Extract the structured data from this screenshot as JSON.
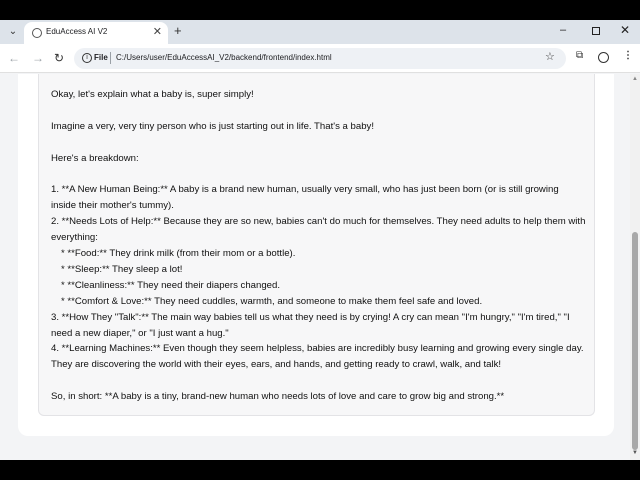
{
  "browser": {
    "tab": {
      "title": "EduAccess AI V2",
      "close_glyph": "✕",
      "favicon": "globe-icon"
    },
    "new_tab_glyph": "+",
    "tab_search_glyph": "⌄",
    "window_controls": {
      "minimize": "–",
      "close": "✕"
    },
    "toolbar": {
      "back_glyph": "←",
      "forward_glyph": "→",
      "reload_glyph": "↻",
      "info_glyph": "i",
      "scheme_label": "File",
      "url": "C:/Users/user/EduAccessAI_V2/backend/frontend/index.html",
      "star_glyph": "☆",
      "extension_glyph": "⧉",
      "menu_glyph": "⋮"
    }
  },
  "response": {
    "intro": "Okay, let's explain what a baby is, super simply!",
    "line2": "Imagine a very, very tiny person who is just starting out in life. That's a baby!",
    "line3": "Here's a breakdown:",
    "item1": "1.  **A New Human Being:** A baby is a brand new human, usually very small, who has just been born (or is still growing inside their mother's tummy).",
    "item2": "2.  **Needs Lots of Help:** Because they are so new, babies can't do much for themselves. They need adults to help them with everything:",
    "bullet1": "*    **Food:** They drink milk (from their mom or a bottle).",
    "bullet2": "*    **Sleep:** They sleep a lot!",
    "bullet3": "*    **Cleanliness:** They need their diapers changed.",
    "bullet4": "*    **Comfort & Love:** They need cuddles, warmth, and someone to make them feel safe and loved.",
    "item3": "3.  **How They \"Talk\":** The main way babies tell us what they need is by crying! A cry can mean \"I'm hungry,\" \"I'm tired,\" \"I need a new diaper,\" or \"I just want a hug.\"",
    "item4": "4.  **Learning Machines:** Even though they seem helpless, babies are incredibly busy learning and growing every single day. They are discovering the world with their eyes, ears, and hands, and getting ready to crawl, walk, and talk!",
    "summary": "So, in short: **A baby is a tiny, brand-new human who needs lots of love and care to grow big and strong.**"
  },
  "scrollbar": {
    "up_glyph": "▲",
    "down_glyph": "▼"
  }
}
